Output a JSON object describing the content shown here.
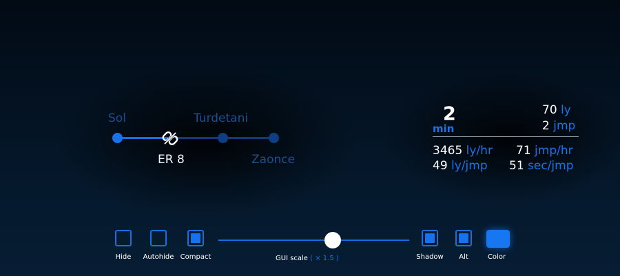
{
  "route": {
    "systems": [
      "Sol",
      "Turdetani",
      "Zaonce"
    ],
    "current_node_label": "ER 8",
    "progress_fraction": 0.25,
    "icon": "broken-link-icon"
  },
  "stats": {
    "eta_value": "2",
    "eta_unit": "min",
    "distance_value": "70",
    "distance_unit": "ly",
    "jumps_value": "2",
    "jumps_unit": "jmp",
    "ly_per_hr_value": "3465",
    "ly_per_hr_unit": "ly/hr",
    "jmp_per_hr_value": "71",
    "jmp_per_hr_unit": "jmp/hr",
    "ly_per_jmp_value": "49",
    "ly_per_jmp_unit": "ly/jmp",
    "sec_per_jmp_value": "51",
    "sec_per_jmp_unit": "sec/jmp"
  },
  "toolbar": {
    "hide_label": "Hide",
    "autohide_label": "Autohide",
    "compact_label": "Compact",
    "scale_label": "GUI scale",
    "scale_value": "( × 1.5 )",
    "scale_fraction": 0.6,
    "shadow_label": "Shadow",
    "alt_label": "Alt",
    "color_label": "Color",
    "states": {
      "hide": false,
      "autohide": false,
      "compact": true,
      "shadow": true,
      "alt": true,
      "color": true
    }
  },
  "colors": {
    "accent": "#1673ea",
    "dim_accent": "#1e4f8f",
    "background": "#041526"
  }
}
